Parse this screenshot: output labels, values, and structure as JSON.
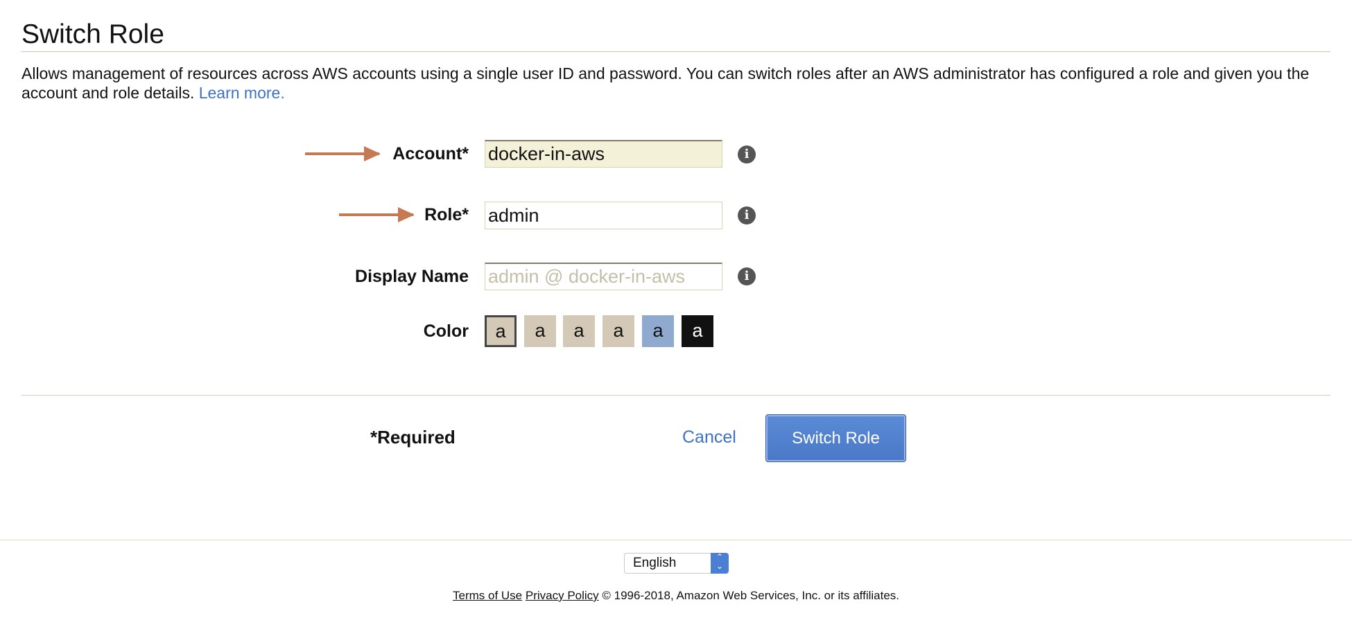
{
  "page": {
    "title": "Switch Role",
    "description": "Allows management of resources across AWS accounts using a single user ID and password. You can switch roles after an AWS administrator has configured a role and given you the account and role details. ",
    "learn_more": "Learn more."
  },
  "form": {
    "account": {
      "label": "Account*",
      "value": "docker-in-aws"
    },
    "role": {
      "label": "Role*",
      "value": "admin"
    },
    "display_name": {
      "label": "Display Name",
      "value": "",
      "placeholder": "admin @ docker-in-aws"
    },
    "color": {
      "label": "Color",
      "swatches": [
        {
          "text": "a",
          "color": "#d4c8b6",
          "selected": true
        },
        {
          "text": "a",
          "color": "#d4c8b6"
        },
        {
          "text": "a",
          "color": "#d4c8b6"
        },
        {
          "text": "a",
          "color": "#d4c8b6"
        },
        {
          "text": "a",
          "color": "#8fa9cf"
        },
        {
          "text": "a",
          "color": "#111111"
        }
      ]
    },
    "info_icon": "i"
  },
  "actions": {
    "required_note": "*Required",
    "cancel": "Cancel",
    "submit": "Switch Role"
  },
  "footer": {
    "language": "English",
    "terms": "Terms of Use",
    "privacy": "Privacy Policy",
    "copyright": " © 1996-2018, Amazon Web Services, Inc. or its affiliates."
  },
  "colors": {
    "accent": "#3f71c2",
    "button": "#4a78c8",
    "annotation_arrow": "#c67a53"
  }
}
